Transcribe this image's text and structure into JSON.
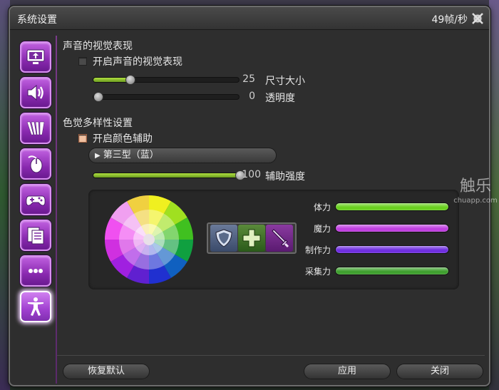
{
  "window": {
    "title": "系统设置",
    "fps": "49帧/秒"
  },
  "sidebar": {
    "items": [
      {
        "name": "display",
        "icon": "monitor-arrow-icon",
        "active": false
      },
      {
        "name": "sound",
        "icon": "speaker-icon",
        "active": false
      },
      {
        "name": "graphics",
        "icon": "panels-icon",
        "active": false
      },
      {
        "name": "mouse",
        "icon": "mouse-icon",
        "active": false
      },
      {
        "name": "gamepad",
        "icon": "gamepad-icon",
        "active": false
      },
      {
        "name": "documents",
        "icon": "documents-icon",
        "active": false
      },
      {
        "name": "more",
        "icon": "ellipsis-icon",
        "active": false
      },
      {
        "name": "accessibility",
        "icon": "accessibility-icon",
        "active": true
      }
    ]
  },
  "sound_visual": {
    "title": "声音的视觉表现",
    "checkbox_label": "开启声音的视觉表现",
    "checked": false,
    "size": {
      "label": "尺寸大小",
      "value": "25",
      "level": 0.25
    },
    "opacity": {
      "label": "透明度",
      "value": "0",
      "level": 0
    }
  },
  "color_vision": {
    "title": "色觉多样性设置",
    "checkbox_label": "开启颜色辅助",
    "checked": true,
    "filter_select": "第三型（蓝）",
    "strength": {
      "label": "辅助强度",
      "value": "100",
      "level": 1.0
    }
  },
  "preview": {
    "roles": [
      "shield-icon",
      "cross-icon",
      "sword-icon"
    ],
    "stats": [
      {
        "label": "体力",
        "color": "#6ad020",
        "level": 1.0
      },
      {
        "label": "魔力",
        "color": "#c040e0",
        "level": 1.0
      },
      {
        "label": "制作力",
        "color": "#7030e0",
        "level": 1.0
      },
      {
        "label": "采集力",
        "color": "#40a030",
        "level": 1.0
      }
    ]
  },
  "footer": {
    "reset": "恢复默认",
    "apply": "应用",
    "close": "关闭"
  },
  "watermark": {
    "main": "触乐",
    "sub": "chuapp.com"
  },
  "colors": {
    "accent": "#a040d0",
    "slider_fill": "#8ac030"
  }
}
